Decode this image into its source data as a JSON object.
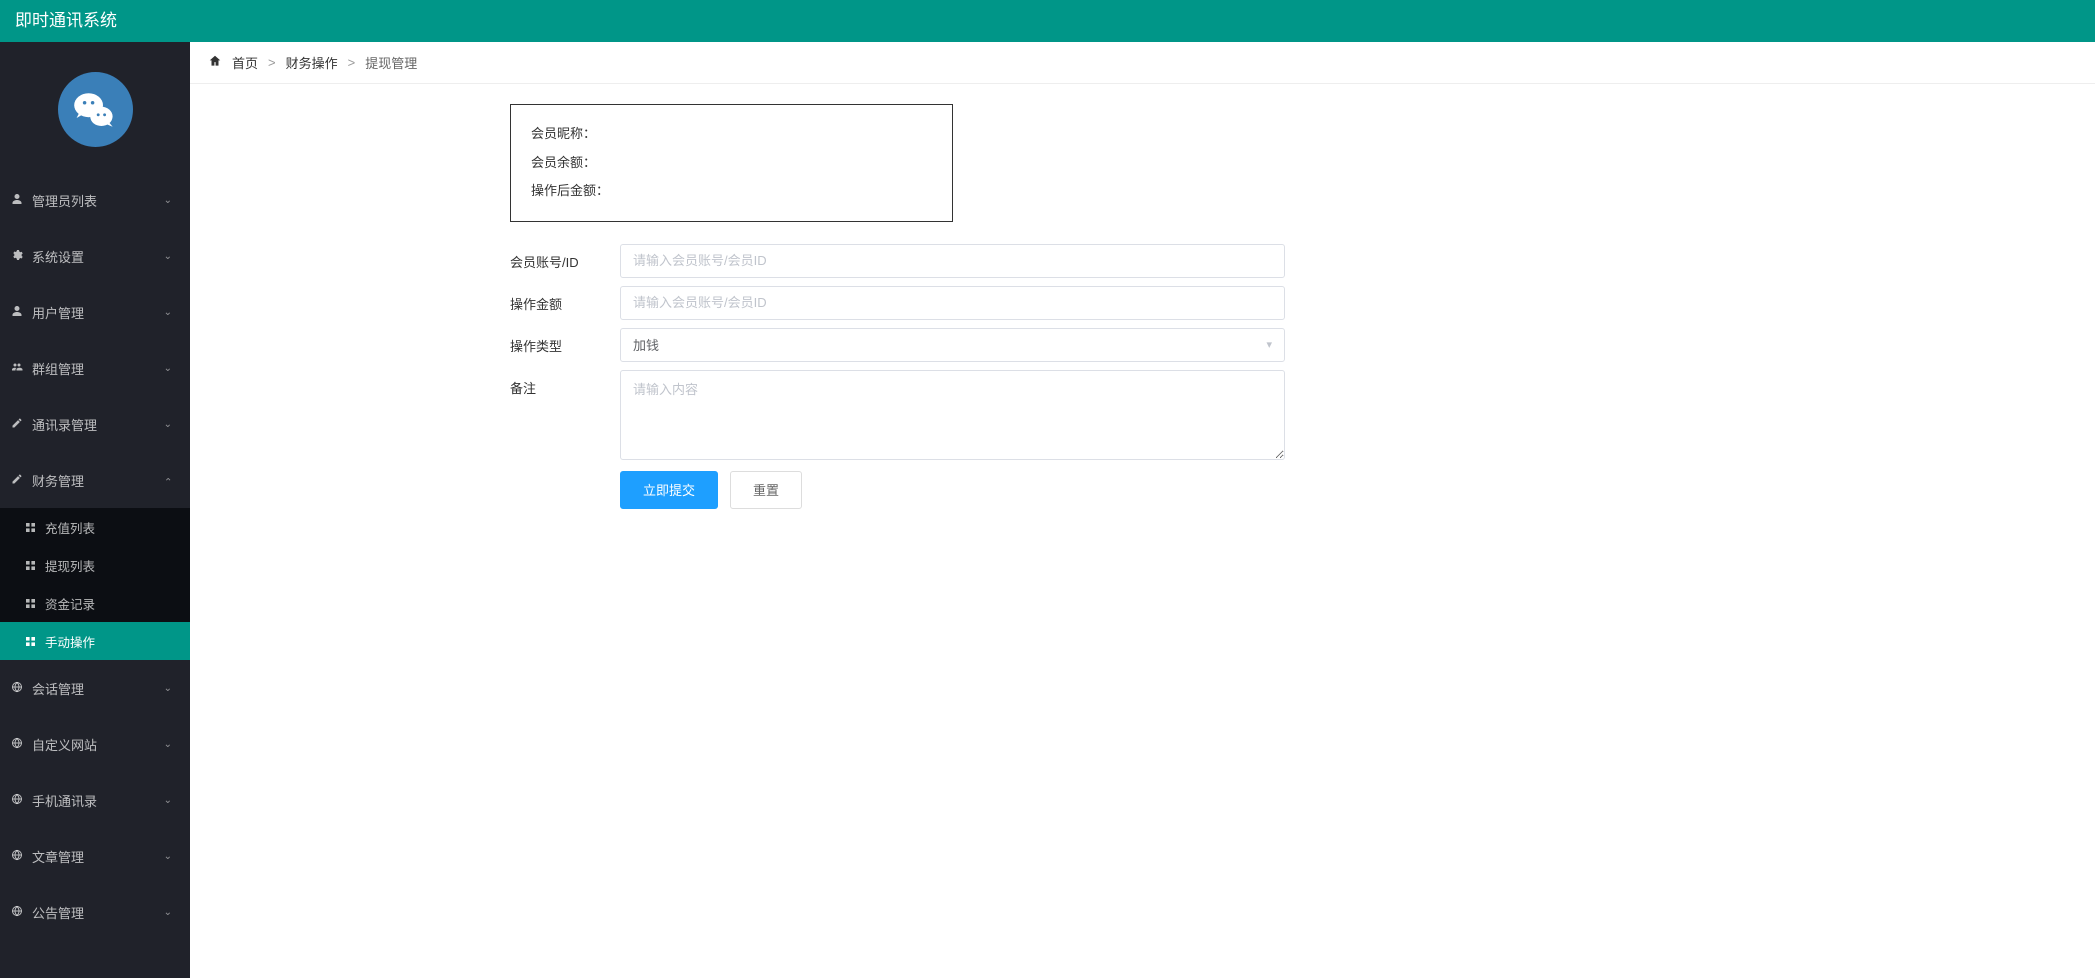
{
  "header": {
    "title": "即时通讯系统"
  },
  "sidebar": {
    "items": [
      {
        "icon": "user-icon",
        "label": "管理员列表"
      },
      {
        "icon": "gear-icon",
        "label": "系统设置"
      },
      {
        "icon": "user-icon",
        "label": "用户管理"
      },
      {
        "icon": "users-icon",
        "label": "群组管理"
      },
      {
        "icon": "edit-icon",
        "label": "通讯录管理"
      },
      {
        "icon": "edit-icon",
        "label": "财务管理",
        "expanded": true,
        "children": [
          {
            "label": "充值列表"
          },
          {
            "label": "提现列表"
          },
          {
            "label": "资金记录"
          },
          {
            "label": "手动操作",
            "active": true
          }
        ]
      },
      {
        "icon": "globe-icon",
        "label": "会话管理"
      },
      {
        "icon": "globe-icon",
        "label": "自定义网站"
      },
      {
        "icon": "globe-icon",
        "label": "手机通讯录"
      },
      {
        "icon": "globe-icon",
        "label": "文章管理"
      },
      {
        "icon": "globe-icon",
        "label": "公告管理"
      }
    ]
  },
  "breadcrumb": {
    "home": "首页",
    "section": "财务操作",
    "page": "提现管理"
  },
  "info_card": {
    "nickname_label": "会员昵称：",
    "balance_label": "会员余额：",
    "after_amount_label": "操作后金额："
  },
  "form": {
    "account_label": "会员账号/ID",
    "account_placeholder": "请输入会员账号/会员ID",
    "amount_label": "操作金额",
    "amount_placeholder": "请输入会员账号/会员ID",
    "type_label": "操作类型",
    "type_value": "加钱",
    "remark_label": "备注",
    "remark_placeholder": "请输入内容",
    "submit": "立即提交",
    "reset": "重置"
  }
}
